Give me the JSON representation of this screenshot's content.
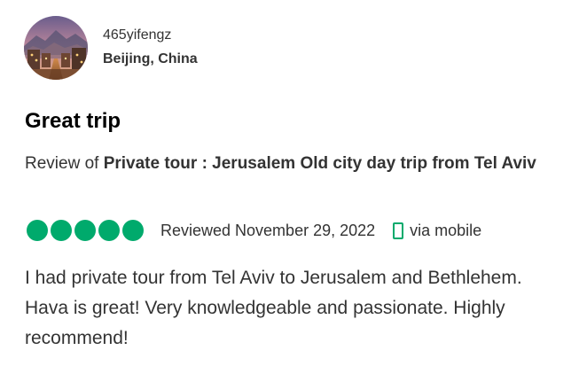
{
  "reviewer": {
    "username": "465yifengz",
    "location": "Beijing, China"
  },
  "review": {
    "title": "Great trip",
    "review_of_prefix": "Review of ",
    "tour_name": "Private tour : Jerusalem Old city day trip from Tel Aviv",
    "rating": 5,
    "rating_max": 5,
    "reviewed_date": "Reviewed November 29, 2022",
    "via": "via mobile",
    "body": "I had private tour from Tel Aviv to Jerusalem and Bethlehem. Hava is great! Very knowledgeable and passionate. Highly recommend!"
  },
  "colors": {
    "bubble": "#00aa6c",
    "text": "#333333",
    "title": "#000000"
  },
  "icons": {
    "mobile": "mobile-phone-icon",
    "avatar": "user-avatar-photo"
  }
}
